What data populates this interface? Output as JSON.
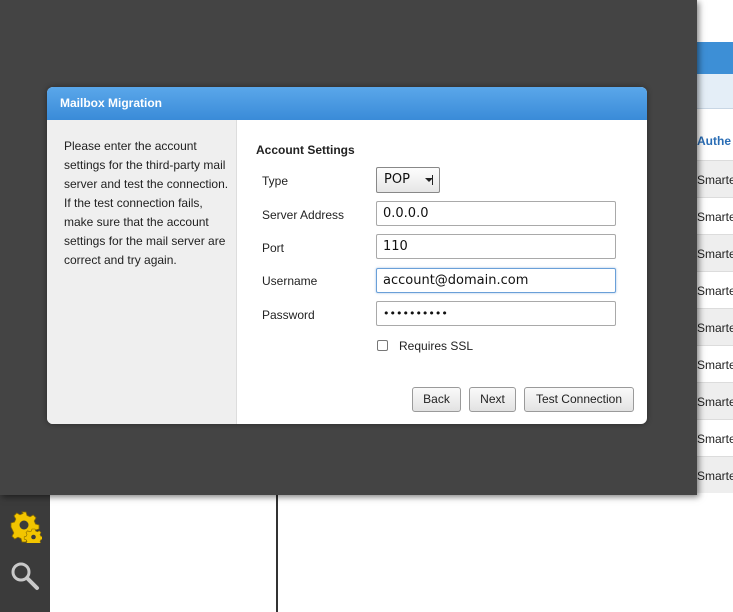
{
  "dialog": {
    "title": "Mailbox Migration",
    "help_text": "Please enter the account settings for the third-party mail server and test the connection. If the test connection fails, make sure that the account settings for the mail server are correct and try again.",
    "section_title": "Account Settings",
    "fields": {
      "type_label": "Type",
      "type_value": "POP",
      "server_label": "Server Address",
      "server_value": "0.0.0.0",
      "port_label": "Port",
      "port_value": "110",
      "username_label": "Username",
      "username_value": "account@domain.com",
      "password_label": "Password",
      "password_value": "••••••••••"
    },
    "ssl_label": "Requires SSL",
    "ssl_checked": false,
    "buttons": {
      "back": "Back",
      "next": "Next",
      "test": "Test Connection"
    }
  },
  "background": {
    "column_header": "Authe",
    "rows": [
      "Smarte",
      "Smarte",
      "Smarte",
      "Smarte",
      "Smarte",
      "Smarte",
      "Smarte",
      "Smarte",
      "Smarte"
    ]
  },
  "colors": {
    "titlebar": "#3a8bd8",
    "overlay": "#444444",
    "gear": "#f2c500"
  },
  "icons": [
    "gear-icon",
    "search-icon"
  ]
}
